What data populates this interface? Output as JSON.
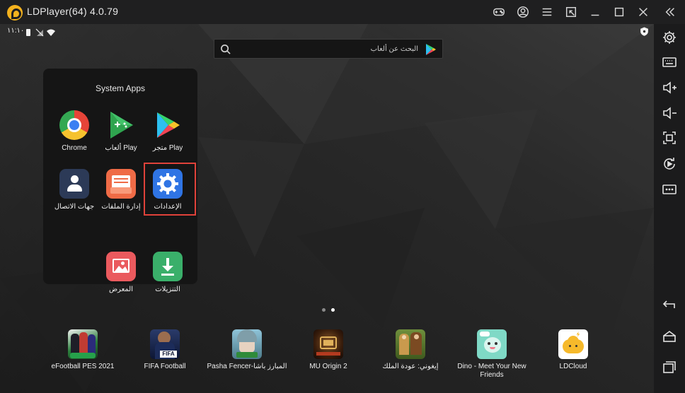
{
  "window": {
    "title": "LDPlayer(64) 4.0.79"
  },
  "status": {
    "time": "١١:١٠"
  },
  "search": {
    "placeholder": "البحث عن ألعاب"
  },
  "folder": {
    "title": "System Apps",
    "apps": [
      {
        "label": "Chrome",
        "icon": "chrome-icon"
      },
      {
        "label": "ألعاب Play",
        "icon": "play-games-icon"
      },
      {
        "label": "متجر Play",
        "icon": "play-store-icon"
      },
      {
        "label": "جهات الاتصال",
        "icon": "contacts-icon"
      },
      {
        "label": "إدارة الملفات",
        "icon": "file-manager-icon"
      },
      {
        "label": "الإعدادات",
        "icon": "settings-icon"
      },
      {
        "label": "المعرض",
        "icon": "gallery-icon"
      },
      {
        "label": "التنزيلات",
        "icon": "downloads-icon"
      }
    ],
    "selected": "الإعدادات"
  },
  "pager": {
    "pages": 2,
    "current": 2
  },
  "dock": [
    {
      "label": "eFootball PES 2021"
    },
    {
      "label": "FIFA Football"
    },
    {
      "label": "Pasha Fencer-المبارز باشا"
    },
    {
      "label": "MU Origin 2"
    },
    {
      "label": "إيغوني: عودة الملك"
    },
    {
      "label": "Dino - Meet Your New Friends"
    },
    {
      "label": "LDCloud"
    }
  ],
  "colors": {
    "accent_orange": "#f4b21e",
    "selection_red": "#e0423a",
    "settings_blue": "#2f74e4",
    "contacts_navy": "#2c3a57",
    "files_orange": "#ef6b46",
    "gallery_red": "#ea5a5e",
    "downloads_green": "#3aaf6a"
  }
}
